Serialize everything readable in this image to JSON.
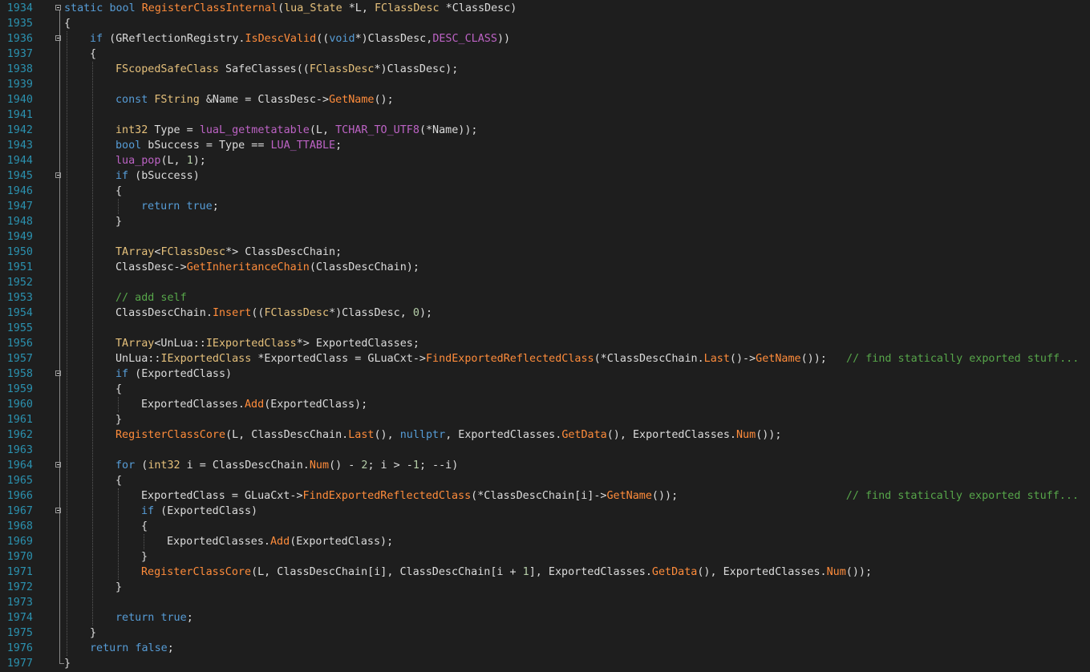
{
  "editor": {
    "language": "cpp",
    "colors": {
      "background": "#1e1e1e",
      "line_number": "#2b91af",
      "plain": "#dcdcdc",
      "keyword": "#569cd6",
      "type": "#d8a0df",
      "class": "#e5c07b",
      "function": "#ff8c3b",
      "macro": "#bd63c5",
      "comment": "#57a64a",
      "number": "#b5cea8"
    },
    "lines": [
      {
        "n": "1934",
        "indent": 0,
        "fold": true,
        "tokens": [
          [
            "kw",
            "static"
          ],
          [
            "pl",
            " "
          ],
          [
            "kw",
            "bool"
          ],
          [
            "pl",
            " "
          ],
          [
            "fn",
            "RegisterClassInternal"
          ],
          [
            "pl",
            "("
          ],
          [
            "cl",
            "lua_State"
          ],
          [
            "pl",
            " *L, "
          ],
          [
            "cl",
            "FClassDesc"
          ],
          [
            "pl",
            " *ClassDesc)"
          ]
        ]
      },
      {
        "n": "1935",
        "indent": 0,
        "fold": false,
        "tokens": [
          [
            "pl",
            "{"
          ]
        ]
      },
      {
        "n": "1936",
        "indent": 1,
        "fold": true,
        "tokens": [
          [
            "kw",
            "if"
          ],
          [
            "pl",
            " (GReflectionRegistry."
          ],
          [
            "fn",
            "IsDescValid"
          ],
          [
            "pl",
            "(("
          ],
          [
            "kw",
            "void"
          ],
          [
            "pl",
            "*)ClassDesc,"
          ],
          [
            "mac",
            "DESC_CLASS"
          ],
          [
            "pl",
            "))"
          ]
        ]
      },
      {
        "n": "1937",
        "indent": 1,
        "fold": false,
        "tokens": [
          [
            "pl",
            "{"
          ]
        ]
      },
      {
        "n": "1938",
        "indent": 2,
        "fold": false,
        "tokens": [
          [
            "cl",
            "FScopedSafeClass"
          ],
          [
            "pl",
            " SafeClasses(("
          ],
          [
            "cl",
            "FClassDesc"
          ],
          [
            "pl",
            "*)ClassDesc);"
          ]
        ]
      },
      {
        "n": "1939",
        "indent": 2,
        "fold": false,
        "tokens": []
      },
      {
        "n": "1940",
        "indent": 2,
        "fold": false,
        "tokens": [
          [
            "kw",
            "const"
          ],
          [
            "pl",
            " "
          ],
          [
            "cl",
            "FString"
          ],
          [
            "pl",
            " &Name = ClassDesc->"
          ],
          [
            "fn",
            "GetName"
          ],
          [
            "pl",
            "();"
          ]
        ]
      },
      {
        "n": "1941",
        "indent": 2,
        "fold": false,
        "tokens": []
      },
      {
        "n": "1942",
        "indent": 2,
        "fold": false,
        "tokens": [
          [
            "cl",
            "int32"
          ],
          [
            "pl",
            " Type = "
          ],
          [
            "mac",
            "luaL_getmetatable"
          ],
          [
            "pl",
            "(L, "
          ],
          [
            "mac",
            "TCHAR_TO_UTF8"
          ],
          [
            "pl",
            "(*Name));"
          ]
        ]
      },
      {
        "n": "1943",
        "indent": 2,
        "fold": false,
        "tokens": [
          [
            "kw",
            "bool"
          ],
          [
            "pl",
            " bSuccess = Type == "
          ],
          [
            "mac",
            "LUA_TTABLE"
          ],
          [
            "pl",
            ";"
          ]
        ]
      },
      {
        "n": "1944",
        "indent": 2,
        "fold": false,
        "tokens": [
          [
            "mac",
            "lua_pop"
          ],
          [
            "pl",
            "(L, "
          ],
          [
            "num",
            "1"
          ],
          [
            "pl",
            ");"
          ]
        ]
      },
      {
        "n": "1945",
        "indent": 2,
        "fold": true,
        "tokens": [
          [
            "kw",
            "if"
          ],
          [
            "pl",
            " (bSuccess)"
          ]
        ]
      },
      {
        "n": "1946",
        "indent": 2,
        "fold": false,
        "tokens": [
          [
            "pl",
            "{"
          ]
        ]
      },
      {
        "n": "1947",
        "indent": 3,
        "fold": false,
        "tokens": [
          [
            "kw",
            "return"
          ],
          [
            "pl",
            " "
          ],
          [
            "kw",
            "true"
          ],
          [
            "pl",
            ";"
          ]
        ]
      },
      {
        "n": "1948",
        "indent": 2,
        "fold": false,
        "tokens": [
          [
            "pl",
            "}"
          ]
        ]
      },
      {
        "n": "1949",
        "indent": 2,
        "fold": false,
        "tokens": []
      },
      {
        "n": "1950",
        "indent": 2,
        "fold": false,
        "tokens": [
          [
            "cl",
            "TArray"
          ],
          [
            "pl",
            "<"
          ],
          [
            "cl",
            "FClassDesc"
          ],
          [
            "pl",
            "*> ClassDescChain;"
          ]
        ]
      },
      {
        "n": "1951",
        "indent": 2,
        "fold": false,
        "tokens": [
          [
            "pl",
            "ClassDesc->"
          ],
          [
            "fn",
            "GetInheritanceChain"
          ],
          [
            "pl",
            "(ClassDescChain);"
          ]
        ]
      },
      {
        "n": "1952",
        "indent": 2,
        "fold": false,
        "tokens": []
      },
      {
        "n": "1953",
        "indent": 2,
        "fold": false,
        "tokens": [
          [
            "cm",
            "// add self"
          ]
        ]
      },
      {
        "n": "1954",
        "indent": 2,
        "fold": false,
        "tokens": [
          [
            "pl",
            "ClassDescChain."
          ],
          [
            "fn",
            "Insert"
          ],
          [
            "pl",
            "(("
          ],
          [
            "cl",
            "FClassDesc"
          ],
          [
            "pl",
            "*)ClassDesc, "
          ],
          [
            "num",
            "0"
          ],
          [
            "pl",
            ");"
          ]
        ]
      },
      {
        "n": "1955",
        "indent": 2,
        "fold": false,
        "tokens": []
      },
      {
        "n": "1956",
        "indent": 2,
        "fold": false,
        "tokens": [
          [
            "cl",
            "TArray"
          ],
          [
            "pl",
            "<UnLua::"
          ],
          [
            "cl",
            "IExportedClass"
          ],
          [
            "pl",
            "*> ExportedClasses;"
          ]
        ]
      },
      {
        "n": "1957",
        "indent": 2,
        "fold": false,
        "tokens": [
          [
            "pl",
            "UnLua::"
          ],
          [
            "cl",
            "IExportedClass"
          ],
          [
            "pl",
            " *ExportedClass = GLuaCxt->"
          ],
          [
            "fn",
            "FindExportedReflectedClass"
          ],
          [
            "pl",
            "(*ClassDescChain."
          ],
          [
            "fn",
            "Last"
          ],
          [
            "pl",
            "()->"
          ],
          [
            "fn",
            "GetName"
          ],
          [
            "pl",
            "());   "
          ],
          [
            "cm",
            "// find statically exported stuff..."
          ]
        ]
      },
      {
        "n": "1958",
        "indent": 2,
        "fold": true,
        "tokens": [
          [
            "kw",
            "if"
          ],
          [
            "pl",
            " (ExportedClass)"
          ]
        ]
      },
      {
        "n": "1959",
        "indent": 2,
        "fold": false,
        "tokens": [
          [
            "pl",
            "{"
          ]
        ]
      },
      {
        "n": "1960",
        "indent": 3,
        "fold": false,
        "tokens": [
          [
            "pl",
            "ExportedClasses."
          ],
          [
            "fn",
            "Add"
          ],
          [
            "pl",
            "(ExportedClass);"
          ]
        ]
      },
      {
        "n": "1961",
        "indent": 2,
        "fold": false,
        "tokens": [
          [
            "pl",
            "}"
          ]
        ]
      },
      {
        "n": "1962",
        "indent": 2,
        "fold": false,
        "tokens": [
          [
            "fn",
            "RegisterClassCore"
          ],
          [
            "pl",
            "(L, ClassDescChain."
          ],
          [
            "fn",
            "Last"
          ],
          [
            "pl",
            "(), "
          ],
          [
            "kw",
            "nullptr"
          ],
          [
            "pl",
            ", ExportedClasses."
          ],
          [
            "fn",
            "GetData"
          ],
          [
            "pl",
            "(), ExportedClasses."
          ],
          [
            "fn",
            "Num"
          ],
          [
            "pl",
            "());"
          ]
        ]
      },
      {
        "n": "1963",
        "indent": 2,
        "fold": false,
        "tokens": []
      },
      {
        "n": "1964",
        "indent": 2,
        "fold": true,
        "tokens": [
          [
            "kw",
            "for"
          ],
          [
            "pl",
            " ("
          ],
          [
            "cl",
            "int32"
          ],
          [
            "pl",
            " i = ClassDescChain."
          ],
          [
            "fn",
            "Num"
          ],
          [
            "pl",
            "() - "
          ],
          [
            "num",
            "2"
          ],
          [
            "pl",
            "; i > -"
          ],
          [
            "num",
            "1"
          ],
          [
            "pl",
            "; --i)"
          ]
        ]
      },
      {
        "n": "1965",
        "indent": 2,
        "fold": false,
        "tokens": [
          [
            "pl",
            "{"
          ]
        ]
      },
      {
        "n": "1966",
        "indent": 3,
        "fold": false,
        "tokens": [
          [
            "pl",
            "ExportedClass = GLuaCxt->"
          ],
          [
            "fn",
            "FindExportedReflectedClass"
          ],
          [
            "pl",
            "(*ClassDescChain[i]->"
          ],
          [
            "fn",
            "GetName"
          ],
          [
            "pl",
            "());                          "
          ],
          [
            "cm",
            "// find statically exported stuff..."
          ]
        ]
      },
      {
        "n": "1967",
        "indent": 3,
        "fold": true,
        "tokens": [
          [
            "kw",
            "if"
          ],
          [
            "pl",
            " (ExportedClass)"
          ]
        ]
      },
      {
        "n": "1968",
        "indent": 3,
        "fold": false,
        "tokens": [
          [
            "pl",
            "{"
          ]
        ]
      },
      {
        "n": "1969",
        "indent": 4,
        "fold": false,
        "tokens": [
          [
            "pl",
            "ExportedClasses."
          ],
          [
            "fn",
            "Add"
          ],
          [
            "pl",
            "(ExportedClass);"
          ]
        ]
      },
      {
        "n": "1970",
        "indent": 3,
        "fold": false,
        "tokens": [
          [
            "pl",
            "}"
          ]
        ]
      },
      {
        "n": "1971",
        "indent": 3,
        "fold": false,
        "tokens": [
          [
            "fn",
            "RegisterClassCore"
          ],
          [
            "pl",
            "(L, ClassDescChain[i], ClassDescChain[i + "
          ],
          [
            "num",
            "1"
          ],
          [
            "pl",
            "], ExportedClasses."
          ],
          [
            "fn",
            "GetData"
          ],
          [
            "pl",
            "(), ExportedClasses."
          ],
          [
            "fn",
            "Num"
          ],
          [
            "pl",
            "());"
          ]
        ]
      },
      {
        "n": "1972",
        "indent": 2,
        "fold": false,
        "tokens": [
          [
            "pl",
            "}"
          ]
        ]
      },
      {
        "n": "1973",
        "indent": 2,
        "fold": false,
        "tokens": []
      },
      {
        "n": "1974",
        "indent": 2,
        "fold": false,
        "tokens": [
          [
            "kw",
            "return"
          ],
          [
            "pl",
            " "
          ],
          [
            "kw",
            "true"
          ],
          [
            "pl",
            ";"
          ]
        ]
      },
      {
        "n": "1975",
        "indent": 1,
        "fold": false,
        "tokens": [
          [
            "pl",
            "}"
          ]
        ]
      },
      {
        "n": "1976",
        "indent": 1,
        "fold": false,
        "tokens": [
          [
            "kw",
            "return"
          ],
          [
            "pl",
            " "
          ],
          [
            "kw",
            "false"
          ],
          [
            "pl",
            ";"
          ]
        ]
      },
      {
        "n": "1977",
        "indent": 0,
        "fold": false,
        "tokens": [
          [
            "pl",
            "}"
          ]
        ]
      }
    ]
  }
}
